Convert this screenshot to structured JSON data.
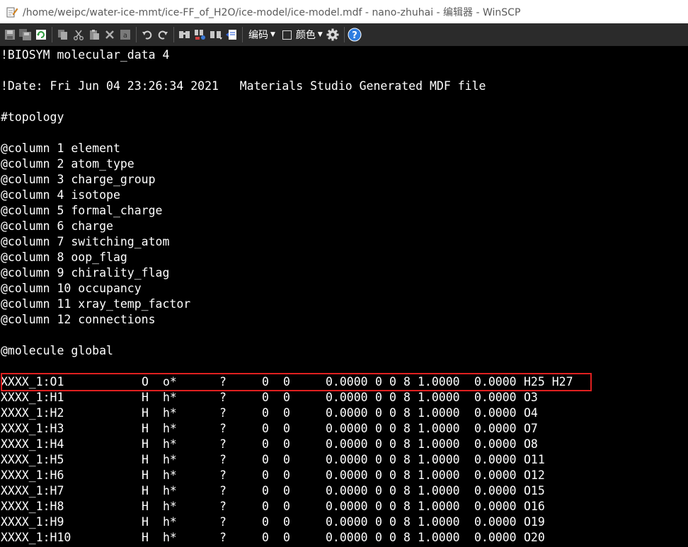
{
  "window": {
    "title": "/home/weipc/water-ice-mmt/ice-FF_of_H2O/ice-model/ice-model.mdf - nano-zhuhai - 编辑器 - WinSCP"
  },
  "toolbar": {
    "encoding_label": "编码",
    "color_label": "颜色",
    "buttons": [
      "save-icon",
      "save-all-icon",
      "reload-icon",
      "copy-icon",
      "cut-icon",
      "paste-icon",
      "delete-icon",
      "select-all-icon",
      "undo-icon",
      "redo-icon",
      "find-icon",
      "replace-icon",
      "find-next-icon",
      "goto-line-icon",
      "settings-icon",
      "help-icon"
    ]
  },
  "editor": {
    "header_lines": [
      "!BIOSYM molecular_data 4",
      "",
      "!Date: Fri Jun 04 23:26:34 2021   Materials Studio Generated MDF file",
      "",
      "#topology",
      "",
      "@column 1 element",
      "@column 2 atom_type",
      "@column 3 charge_group",
      "@column 4 isotope",
      "@column 5 formal_charge",
      "@column 6 charge",
      "@column 7 switching_atom",
      "@column 8 oop_flag",
      "@column 9 chirality_flag",
      "@column 10 occupancy",
      "@column 11 xray_temp_factor",
      "@column 12 connections",
      "",
      "@molecule global",
      ""
    ],
    "atoms": [
      {
        "name": "XXXX_1:O1",
        "element": "O",
        "type": "o*",
        "group": "?",
        "isotope": "0",
        "formal": "0",
        "charge": "0.0000",
        "switch": "0",
        "oop": "0",
        "chir": "8",
        "occ": "1.0000",
        "xray": "0.0000",
        "conn": "H25 H27"
      },
      {
        "name": "XXXX_1:H1",
        "element": "H",
        "type": "h*",
        "group": "?",
        "isotope": "0",
        "formal": "0",
        "charge": "0.0000",
        "switch": "0",
        "oop": "0",
        "chir": "8",
        "occ": "1.0000",
        "xray": "0.0000",
        "conn": "O3"
      },
      {
        "name": "XXXX_1:H2",
        "element": "H",
        "type": "h*",
        "group": "?",
        "isotope": "0",
        "formal": "0",
        "charge": "0.0000",
        "switch": "0",
        "oop": "0",
        "chir": "8",
        "occ": "1.0000",
        "xray": "0.0000",
        "conn": "O4"
      },
      {
        "name": "XXXX_1:H3",
        "element": "H",
        "type": "h*",
        "group": "?",
        "isotope": "0",
        "formal": "0",
        "charge": "0.0000",
        "switch": "0",
        "oop": "0",
        "chir": "8",
        "occ": "1.0000",
        "xray": "0.0000",
        "conn": "O7"
      },
      {
        "name": "XXXX_1:H4",
        "element": "H",
        "type": "h*",
        "group": "?",
        "isotope": "0",
        "formal": "0",
        "charge": "0.0000",
        "switch": "0",
        "oop": "0",
        "chir": "8",
        "occ": "1.0000",
        "xray": "0.0000",
        "conn": "O8"
      },
      {
        "name": "XXXX_1:H5",
        "element": "H",
        "type": "h*",
        "group": "?",
        "isotope": "0",
        "formal": "0",
        "charge": "0.0000",
        "switch": "0",
        "oop": "0",
        "chir": "8",
        "occ": "1.0000",
        "xray": "0.0000",
        "conn": "O11"
      },
      {
        "name": "XXXX_1:H6",
        "element": "H",
        "type": "h*",
        "group": "?",
        "isotope": "0",
        "formal": "0",
        "charge": "0.0000",
        "switch": "0",
        "oop": "0",
        "chir": "8",
        "occ": "1.0000",
        "xray": "0.0000",
        "conn": "O12"
      },
      {
        "name": "XXXX_1:H7",
        "element": "H",
        "type": "h*",
        "group": "?",
        "isotope": "0",
        "formal": "0",
        "charge": "0.0000",
        "switch": "0",
        "oop": "0",
        "chir": "8",
        "occ": "1.0000",
        "xray": "0.0000",
        "conn": "O15"
      },
      {
        "name": "XXXX_1:H8",
        "element": "H",
        "type": "h*",
        "group": "?",
        "isotope": "0",
        "formal": "0",
        "charge": "0.0000",
        "switch": "0",
        "oop": "0",
        "chir": "8",
        "occ": "1.0000",
        "xray": "0.0000",
        "conn": "O16"
      },
      {
        "name": "XXXX_1:H9",
        "element": "H",
        "type": "h*",
        "group": "?",
        "isotope": "0",
        "formal": "0",
        "charge": "0.0000",
        "switch": "0",
        "oop": "0",
        "chir": "8",
        "occ": "1.0000",
        "xray": "0.0000",
        "conn": "O19"
      },
      {
        "name": "XXXX_1:H10",
        "element": "H",
        "type": "h*",
        "group": "?",
        "isotope": "0",
        "formal": "0",
        "charge": "0.0000",
        "switch": "0",
        "oop": "0",
        "chir": "8",
        "occ": "1.0000",
        "xray": "0.0000",
        "conn": "O20"
      }
    ],
    "highlight_color": "#e02020"
  }
}
